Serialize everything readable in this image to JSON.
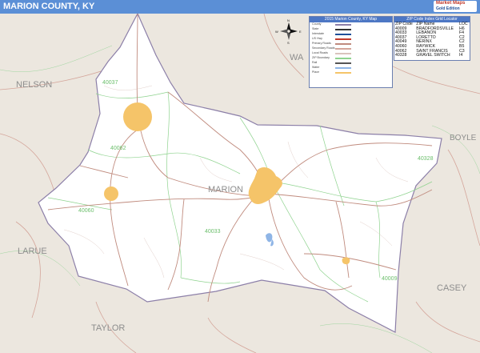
{
  "title": "MARION COUNTY, KY",
  "brand": {
    "line1": "Market",
    "line2": "Maps",
    "line3": "Gold Edition"
  },
  "legend": {
    "title": "2015 Marion County, KY Map",
    "rows": [
      {
        "label": "County",
        "value": ""
      },
      {
        "label": "State",
        "value": ""
      },
      {
        "label": "Interstate",
        "value": ""
      },
      {
        "label": "US Hwy",
        "value": ""
      },
      {
        "label": "Primary Roads",
        "value": ""
      },
      {
        "label": "Secondary Roads",
        "value": ""
      },
      {
        "label": "Local Roads",
        "value": ""
      },
      {
        "label": "ZIP Boundary",
        "value": ""
      },
      {
        "label": "Rail",
        "value": ""
      },
      {
        "label": "Water",
        "value": ""
      },
      {
        "label": "Place",
        "value": ""
      }
    ]
  },
  "zip_table": {
    "title": "ZIP Code Index Grid Locator",
    "headers": [
      "ZIP Code",
      "ZIP Name",
      "LOC"
    ],
    "rows": [
      [
        "40009",
        "BRADFORDSVILLE",
        "H6"
      ],
      [
        "40033",
        "LEBANON",
        "F4"
      ],
      [
        "40037",
        "LORETTO",
        "C2"
      ],
      [
        "40049",
        "NERINX",
        "C2"
      ],
      [
        "40060",
        "RAYWICK",
        "B5"
      ],
      [
        "40062",
        "SAINT FRANCIS",
        "C3"
      ],
      [
        "40328",
        "GRAVEL SWITCH",
        "I4"
      ]
    ]
  },
  "neighbors": {
    "nelson": "NELSON",
    "boyle": "BOYLE",
    "larue": "LARUE",
    "taylor": "TAYLOR",
    "casey": "CASEY",
    "washington": "WA"
  },
  "place_label": "MARION",
  "zip_labels": {
    "z40037": "40037",
    "z40062": "40062",
    "z40060": "40060",
    "z40033": "40033",
    "z40328": "40328",
    "z40009": "40009"
  },
  "compass": {
    "n": "N",
    "s": "S",
    "e": "E",
    "w": "W"
  },
  "colors": {
    "title_bar": "#5b8fd6",
    "outside": "#ece7df",
    "county": "#ffffff",
    "road": "#c08b7e",
    "zip_boundary": "#8fd38f",
    "place": "#f5c469",
    "water": "#8fb5e6"
  }
}
